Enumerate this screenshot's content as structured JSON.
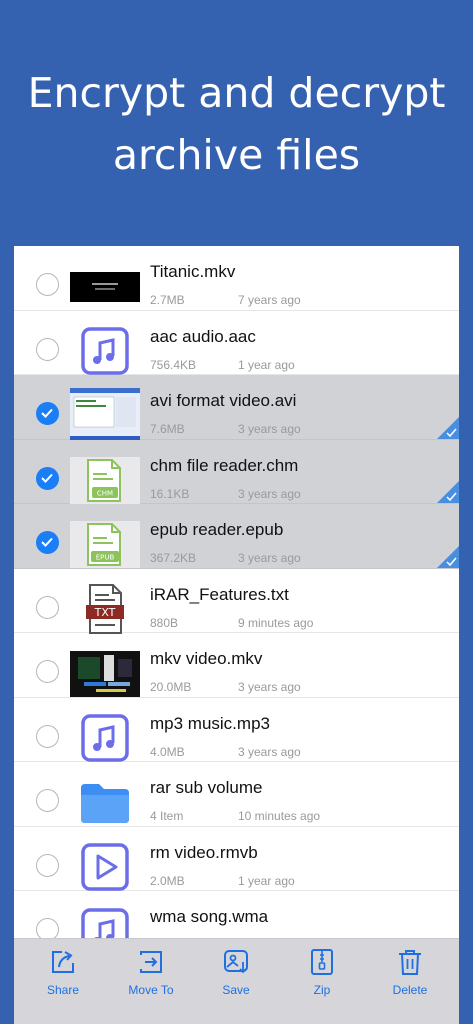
{
  "headline": {
    "line1": "Encrypt and decrypt",
    "line2": "archive files"
  },
  "files": [
    {
      "name": "Titanic.mkv",
      "size": "2.7MB",
      "age": "7 years ago",
      "selected": false,
      "thumb": "video-thumb"
    },
    {
      "name": "aac audio.aac",
      "size": "756.4KB",
      "age": "1 year ago",
      "selected": false,
      "thumb": "music-icon"
    },
    {
      "name": "avi format video.avi",
      "size": "7.6MB",
      "age": "3 years ago",
      "selected": true,
      "thumb": "screenshot-thumb"
    },
    {
      "name": "chm file reader.chm",
      "size": "16.1KB",
      "age": "3 years ago",
      "selected": true,
      "thumb": "chm-file-icon",
      "badge": "CHM"
    },
    {
      "name": "epub reader.epub",
      "size": "367.2KB",
      "age": "3 years ago",
      "selected": true,
      "thumb": "epub-file-icon",
      "badge": "EPUB"
    },
    {
      "name": "iRAR_Features.txt",
      "size": "880B",
      "age": "9 minutes ago",
      "selected": false,
      "thumb": "txt-file-icon",
      "badge": "TXT"
    },
    {
      "name": "mkv video.mkv",
      "size": "20.0MB",
      "age": "3 years ago",
      "selected": false,
      "thumb": "video-thumb"
    },
    {
      "name": "mp3 music.mp3",
      "size": "4.0MB",
      "age": "3 years ago",
      "selected": false,
      "thumb": "music-icon"
    },
    {
      "name": "rar sub volume",
      "size": "4 Item",
      "age": "10 minutes ago",
      "selected": false,
      "thumb": "folder-icon"
    },
    {
      "name": "rm video.rmvb",
      "size": "2.0MB",
      "age": "1 year ago",
      "selected": false,
      "thumb": "play-icon"
    },
    {
      "name": "wma song.wma",
      "size": "",
      "age": "",
      "selected": false,
      "thumb": "music-icon"
    }
  ],
  "toolbar": {
    "share": "Share",
    "move_to": "Move To",
    "save": "Save",
    "zip": "Zip",
    "delete": "Delete"
  },
  "colors": {
    "background": "#3562b0",
    "accent": "#1a7ef6",
    "icon": "#6b6ee8",
    "selected_row": "#d1d2d6"
  }
}
